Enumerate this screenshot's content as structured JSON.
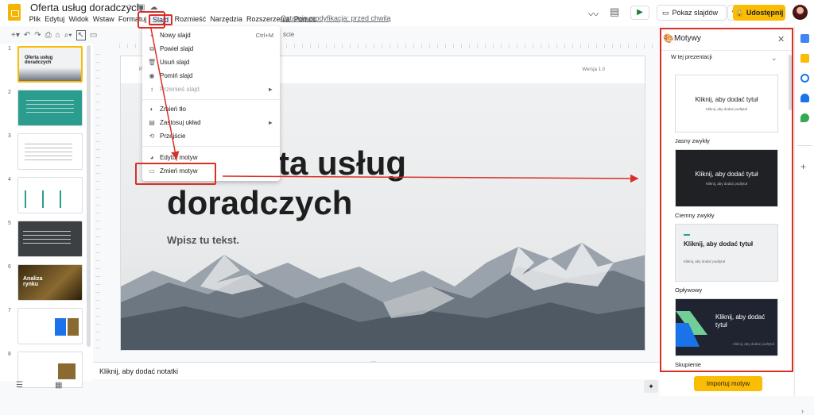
{
  "header": {
    "doc_title": "Oferta usług doradczych",
    "last_modified": "Ostatnia modyfikacja: przed chwilą",
    "slideshow_label": "Pokaz slajdów",
    "share_label": "Udostępnij"
  },
  "menubar": [
    "Plik",
    "Edytuj",
    "Widok",
    "Wstaw",
    "Formatuj",
    "Slajd",
    "Rozmieść",
    "Narzędzia",
    "Rozszerzenia",
    "Pomoc"
  ],
  "slide_menu": {
    "items": [
      {
        "icon": "+",
        "label": "Nowy slajd",
        "shortcut": "Ctrl+M"
      },
      {
        "icon": "⧉",
        "label": "Powiel slajd",
        "shortcut": ""
      },
      {
        "icon": "🗑",
        "label": "Usuń slajd",
        "shortcut": ""
      },
      {
        "icon": "◉",
        "label": "Pomiń slajd",
        "shortcut": ""
      },
      {
        "icon": "↕",
        "label": "Przenieś slajd",
        "shortcut": "►"
      },
      {
        "icon": "◐",
        "label": "Zmień tło",
        "shortcut": ""
      },
      {
        "icon": "▤",
        "label": "Zastosuj układ",
        "shortcut": "►"
      },
      {
        "icon": "⟲",
        "label": "Przejście",
        "shortcut": ""
      },
      {
        "icon": "◕",
        "label": "Edytuj motyw",
        "shortcut": ""
      },
      {
        "icon": "▭",
        "label": "Zmień motyw",
        "shortcut": ""
      }
    ]
  },
  "toolbar": {
    "partial_label": "ście"
  },
  "slide": {
    "header_left": "Po",
    "header_right": "Wersja 1.0",
    "title": "Oferta usług doradczych",
    "title_line1": "ta usług",
    "title_line2": "doradczych",
    "subtitle": "Wpisz tu tekst."
  },
  "notes": {
    "placeholder": "Kliknij, aby dodać notatki"
  },
  "filmstrip": {
    "numbers": [
      "1",
      "2",
      "3",
      "4",
      "5",
      "6",
      "7",
      "8"
    ],
    "thumb1_title": "Oferta usług doradczych",
    "thumb6_title": "Analiza rynku"
  },
  "themes_panel": {
    "title": "Motywy",
    "filter": "W tej prezentacji",
    "themes": [
      {
        "name": "Jasny zwykły",
        "title": "Kliknij, aby dodać tytuł",
        "subtitle": "Kliknij, aby dodać podtytuł"
      },
      {
        "name": "Ciemny zwykły",
        "title": "Kliknij, aby dodać tytuł",
        "subtitle": "Kliknij, aby dodać podtytuł"
      },
      {
        "name": "Opływowy",
        "title": "Kliknij, aby dodać tytuł",
        "subtitle": "Kliknij, aby dodać podtytuł"
      },
      {
        "name": "Skupienie",
        "title": "Kliknij, aby dodać tytuł",
        "subtitle": "Kliknij, aby dodać podtytuł"
      }
    ],
    "import_label": "Importuj motyw"
  },
  "colors": {
    "accent": "#fbbc04",
    "highlight": "#d93025",
    "teal": "#2a9d8f"
  }
}
